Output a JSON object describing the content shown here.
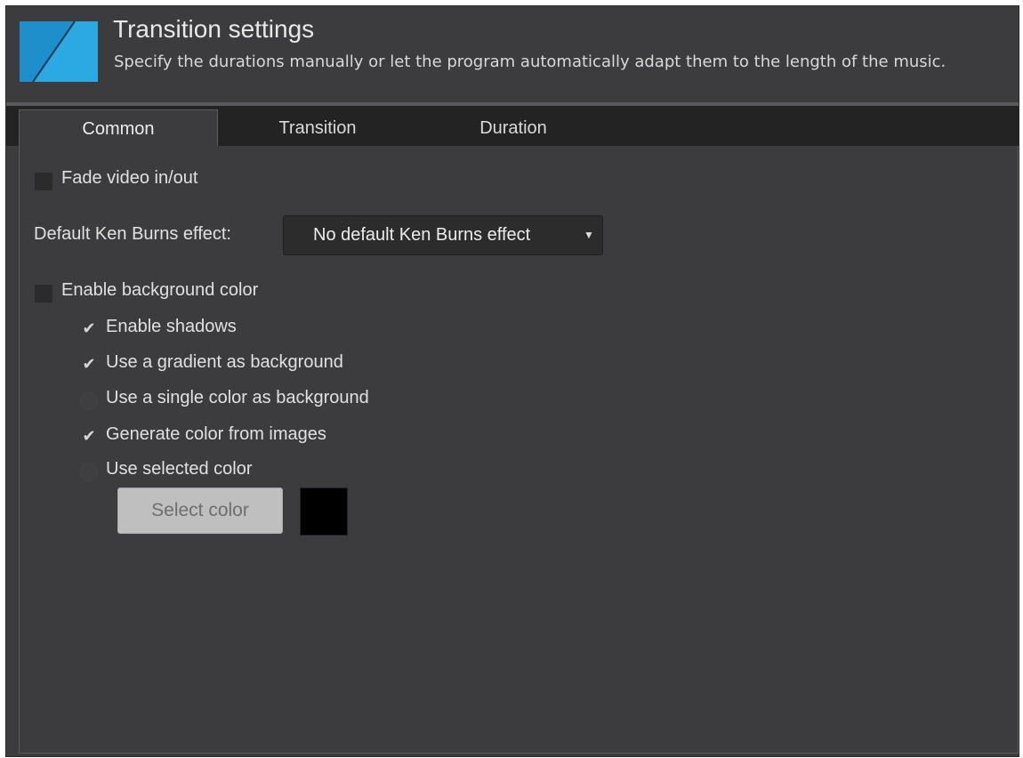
{
  "header": {
    "title": "Transition settings",
    "subtitle": "Specify the durations manually or let the program automatically adapt them to the length of the music.",
    "logo_color": "#29a8e0"
  },
  "tabs": [
    {
      "label": "Common",
      "active": true
    },
    {
      "label": "Transition",
      "active": false
    },
    {
      "label": "Duration",
      "active": false
    }
  ],
  "common": {
    "fade_video": {
      "label": "Fade video in/out",
      "checked": false
    },
    "ken_burns": {
      "label": "Default Ken Burns effect:",
      "value": "No default Ken Burns effect"
    },
    "enable_background_color": {
      "label": "Enable background color",
      "checked": false
    },
    "enable_shadows": {
      "label": "Enable shadows",
      "checked": true
    },
    "use_gradient": {
      "label": "Use a gradient as background",
      "checked": true
    },
    "use_single_color": {
      "label": "Use a single color as background",
      "checked": false
    },
    "generate_color": {
      "label": "Generate color from images",
      "checked": true
    },
    "use_selected_color": {
      "label": "Use selected color",
      "checked": false
    },
    "select_color_button": "Select color",
    "selected_color": "#000000"
  }
}
